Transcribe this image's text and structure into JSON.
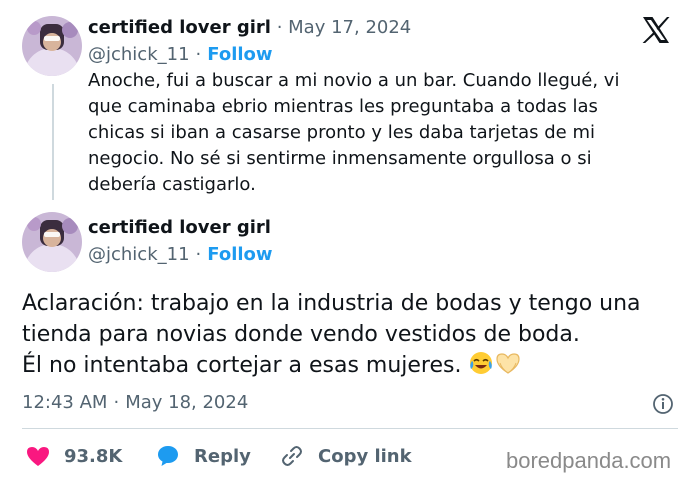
{
  "reply_tweet": {
    "author_name": "certified lover girl",
    "separator": "·",
    "date": "May 17, 2024",
    "handle": "@jchick_11",
    "follow_label": "Follow",
    "lines": [
      "Anoche, fui a buscar a mi novio a un bar. Cuando llegué, vi",
      "que caminaba ebrio mientras les preguntaba a todas las",
      "chicas si iban a casarse pronto y les daba tarjetas de mi",
      "negocio. No sé si sentirme inmensamente orgullosa o si",
      "debería castigarlo."
    ]
  },
  "main_tweet": {
    "author_name": "certified lover girl",
    "handle": "@jchick_11",
    "separator": "·",
    "follow_label": "Follow",
    "lines": [
      "Aclaración: trabajo en la industria de bodas y tengo una",
      "tienda para novias donde vendo vestidos de boda.",
      "Él no intentaba cortejar a esas mujeres."
    ],
    "emojis": [
      "laughing-crying-emoji",
      "heart-hands-emoji"
    ],
    "time": "12:43 AM",
    "date": "May 18, 2024"
  },
  "actions": {
    "like_count": "93.8K",
    "reply_label": "Reply",
    "copy_label": "Copy link"
  },
  "icons": {
    "logo": "x-logo-icon",
    "like": "heart-icon",
    "reply": "speech-bubble-icon",
    "copy": "link-icon",
    "info": "info-icon"
  },
  "colors": {
    "text": "#0f1419",
    "muted": "#536471",
    "accent": "#1d9bf0",
    "like": "#f91880",
    "divider": "#cfd9de"
  },
  "watermark": "boredpanda.com"
}
